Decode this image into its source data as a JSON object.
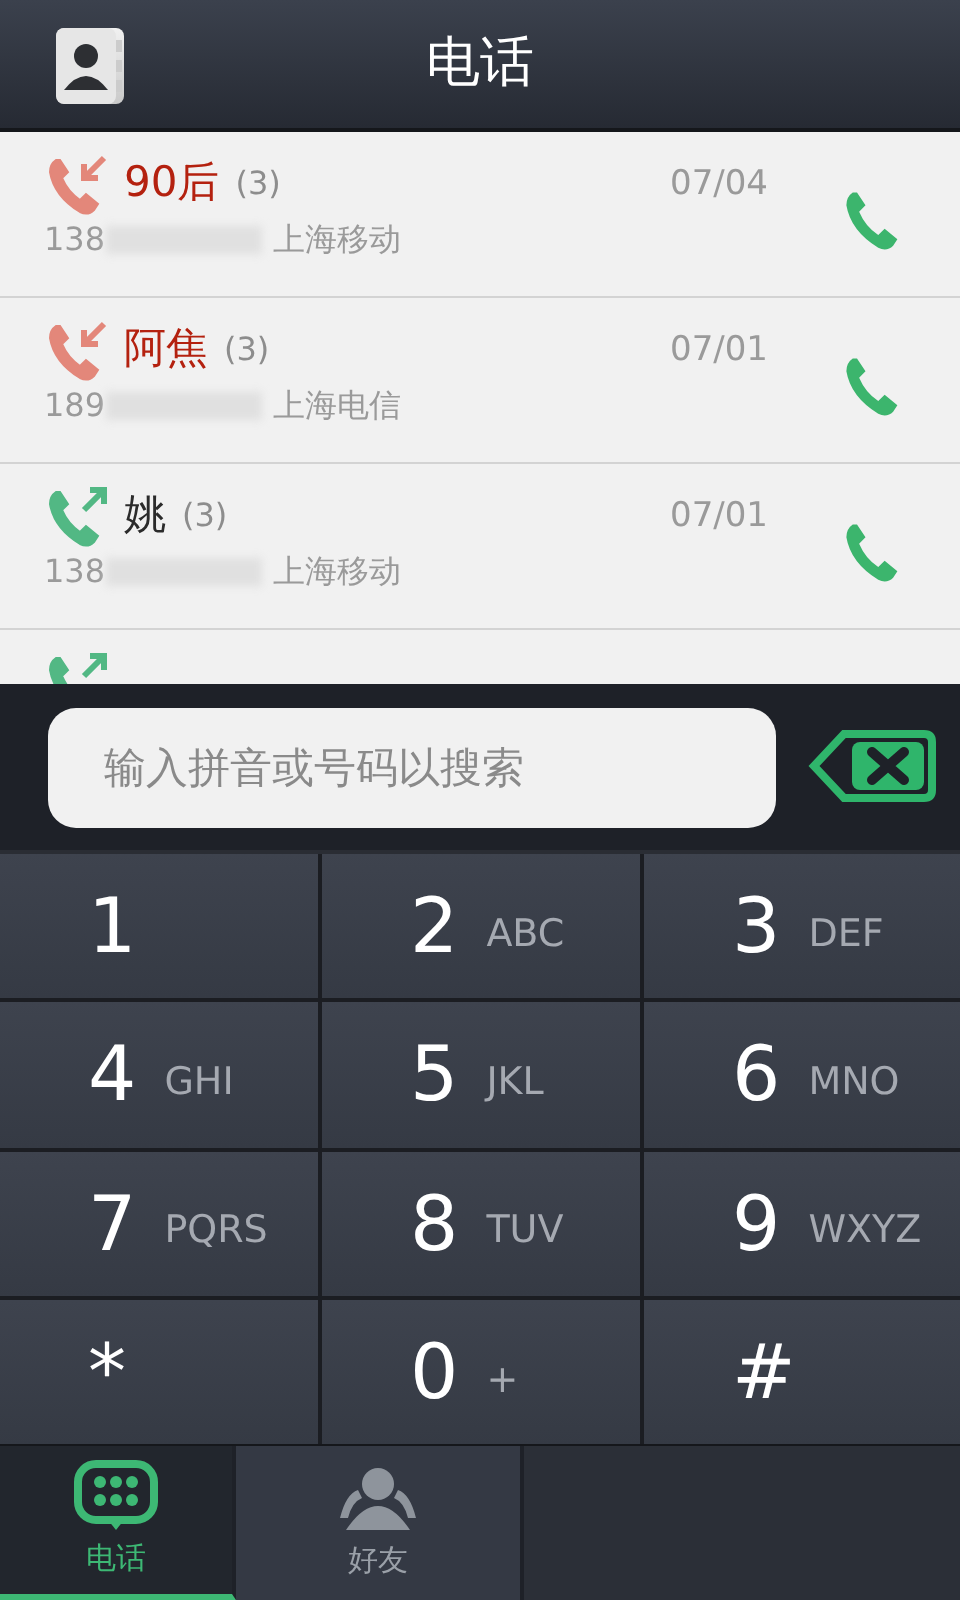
{
  "header": {
    "title": "电话"
  },
  "calls": [
    {
      "kind": "missed",
      "name": "90后",
      "count": "(3)",
      "date": "07/04",
      "number": "138",
      "carrier": "上海移动"
    },
    {
      "kind": "missed",
      "name": "阿焦",
      "count": "(3)",
      "date": "07/01",
      "number": "189",
      "carrier": "上海电信"
    },
    {
      "kind": "outgoing",
      "name": "姚",
      "count": "(3)",
      "date": "07/01",
      "number": "138",
      "carrier": "上海移动"
    },
    {
      "kind": "outgoing"
    }
  ],
  "search": {
    "placeholder": "输入拼音或号码以搜索"
  },
  "keypad": [
    {
      "digit": "1"
    },
    {
      "digit": "2",
      "letters": "ABC"
    },
    {
      "digit": "3",
      "letters": "DEF"
    },
    {
      "digit": "4",
      "letters": "GHI"
    },
    {
      "digit": "5",
      "letters": "JKL"
    },
    {
      "digit": "6",
      "letters": "MNO"
    },
    {
      "digit": "7",
      "letters": "PQRS"
    },
    {
      "digit": "8",
      "letters": "TUV"
    },
    {
      "digit": "9",
      "letters": "WXYZ"
    },
    {
      "digit": "*"
    },
    {
      "digit": "0",
      "letters": "+"
    },
    {
      "digit": "#"
    }
  ],
  "tabs": [
    {
      "kind": "dialer",
      "label": "电话",
      "selected": true
    },
    {
      "kind": "friends",
      "label": "好友",
      "selected": false
    }
  ]
}
